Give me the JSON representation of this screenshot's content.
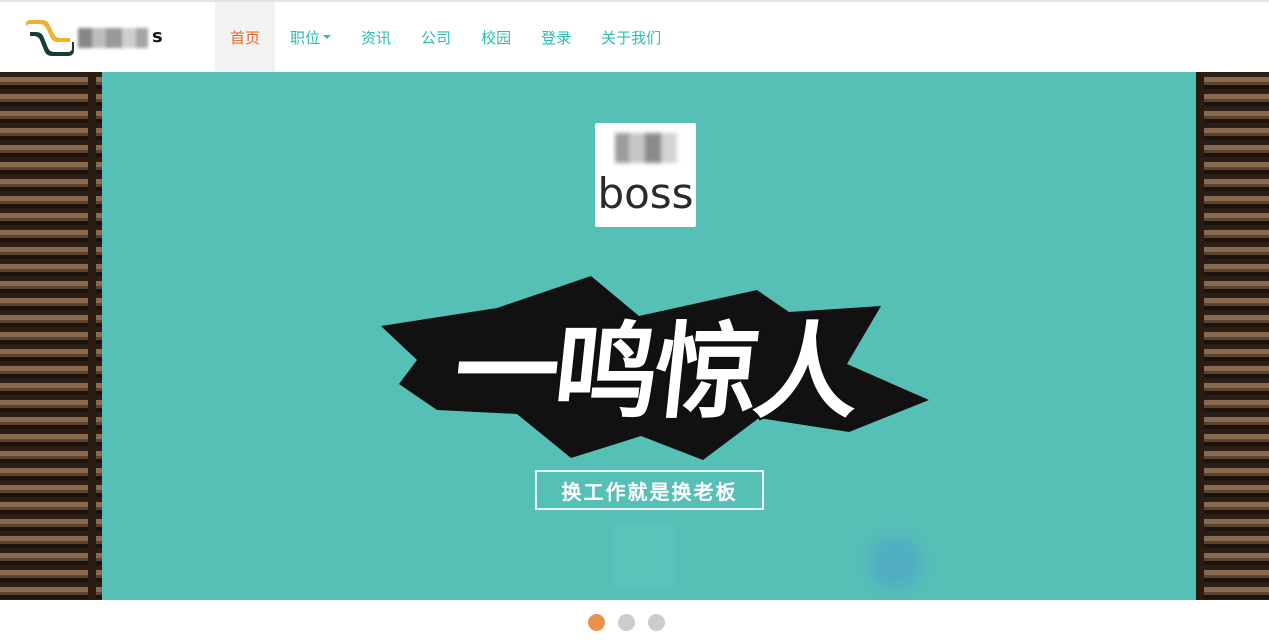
{
  "nav": {
    "items": [
      {
        "label": "首页",
        "active": true
      },
      {
        "label": "职位",
        "dropdown": true
      },
      {
        "label": "资讯"
      },
      {
        "label": "公司"
      },
      {
        "label": "校园"
      },
      {
        "label": "登录"
      },
      {
        "label": "关于我们"
      }
    ]
  },
  "brand": {
    "text_visible": "s",
    "mark_colors": {
      "yellow": "#f1b12a",
      "dark": "#173c3a"
    }
  },
  "banner": {
    "logo_card_text": "boss",
    "headline": "一鸣惊人",
    "tagline": "换工作就是换老板",
    "colors": {
      "background": "#56bfb6",
      "accent": "#e8682c"
    }
  },
  "carousel": {
    "slide_count": 3,
    "active_index": 0
  }
}
